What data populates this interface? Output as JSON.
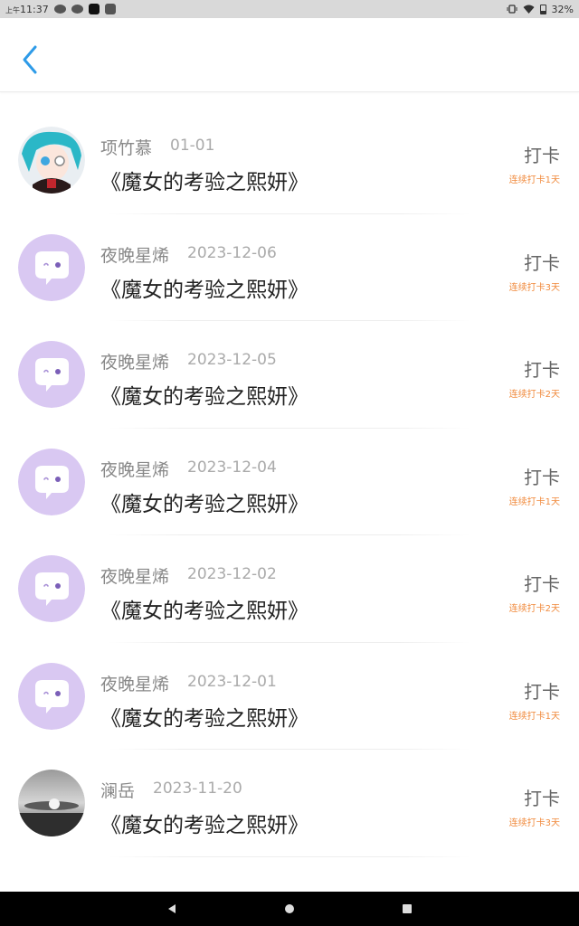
{
  "status_bar": {
    "time_prefix": "上午",
    "time": "11:37",
    "battery": "32%"
  },
  "header": {
    "back_icon": "chevron-left-icon"
  },
  "colors": {
    "accent": "#2e9be8",
    "streak": "#f08a3c",
    "default_avatar_bg": "#d9c8f2"
  },
  "entries": [
    {
      "user": "项竹慕",
      "date": "01-01",
      "title": "《魔女的考验之熙妍》",
      "action": "打卡",
      "streak": "连续打卡1天",
      "avatar": "anime-avatar"
    },
    {
      "user": "夜晚星烯",
      "date": "2023-12-06",
      "title": "《魔女的考验之熙妍》",
      "action": "打卡",
      "streak": "连续打卡3天",
      "avatar": "chat-bubble-avatar"
    },
    {
      "user": "夜晚星烯",
      "date": "2023-12-05",
      "title": "《魔女的考验之熙妍》",
      "action": "打卡",
      "streak": "连续打卡2天",
      "avatar": "chat-bubble-avatar"
    },
    {
      "user": "夜晚星烯",
      "date": "2023-12-04",
      "title": "《魔女的考验之熙妍》",
      "action": "打卡",
      "streak": "连续打卡1天",
      "avatar": "chat-bubble-avatar"
    },
    {
      "user": "夜晚星烯",
      "date": "2023-12-02",
      "title": "《魔女的考验之熙妍》",
      "action": "打卡",
      "streak": "连续打卡2天",
      "avatar": "chat-bubble-avatar"
    },
    {
      "user": "夜晚星烯",
      "date": "2023-12-01",
      "title": "《魔女的考验之熙妍》",
      "action": "打卡",
      "streak": "连续打卡1天",
      "avatar": "chat-bubble-avatar"
    },
    {
      "user": "澜岳",
      "date": "2023-11-20",
      "title": "《魔女的考验之熙妍》",
      "action": "打卡",
      "streak": "连续打卡3天",
      "avatar": "photo-avatar"
    }
  ],
  "nav_bar": {
    "back_icon": "triangle-back-icon",
    "home_icon": "circle-home-icon",
    "recents_icon": "square-recents-icon"
  }
}
